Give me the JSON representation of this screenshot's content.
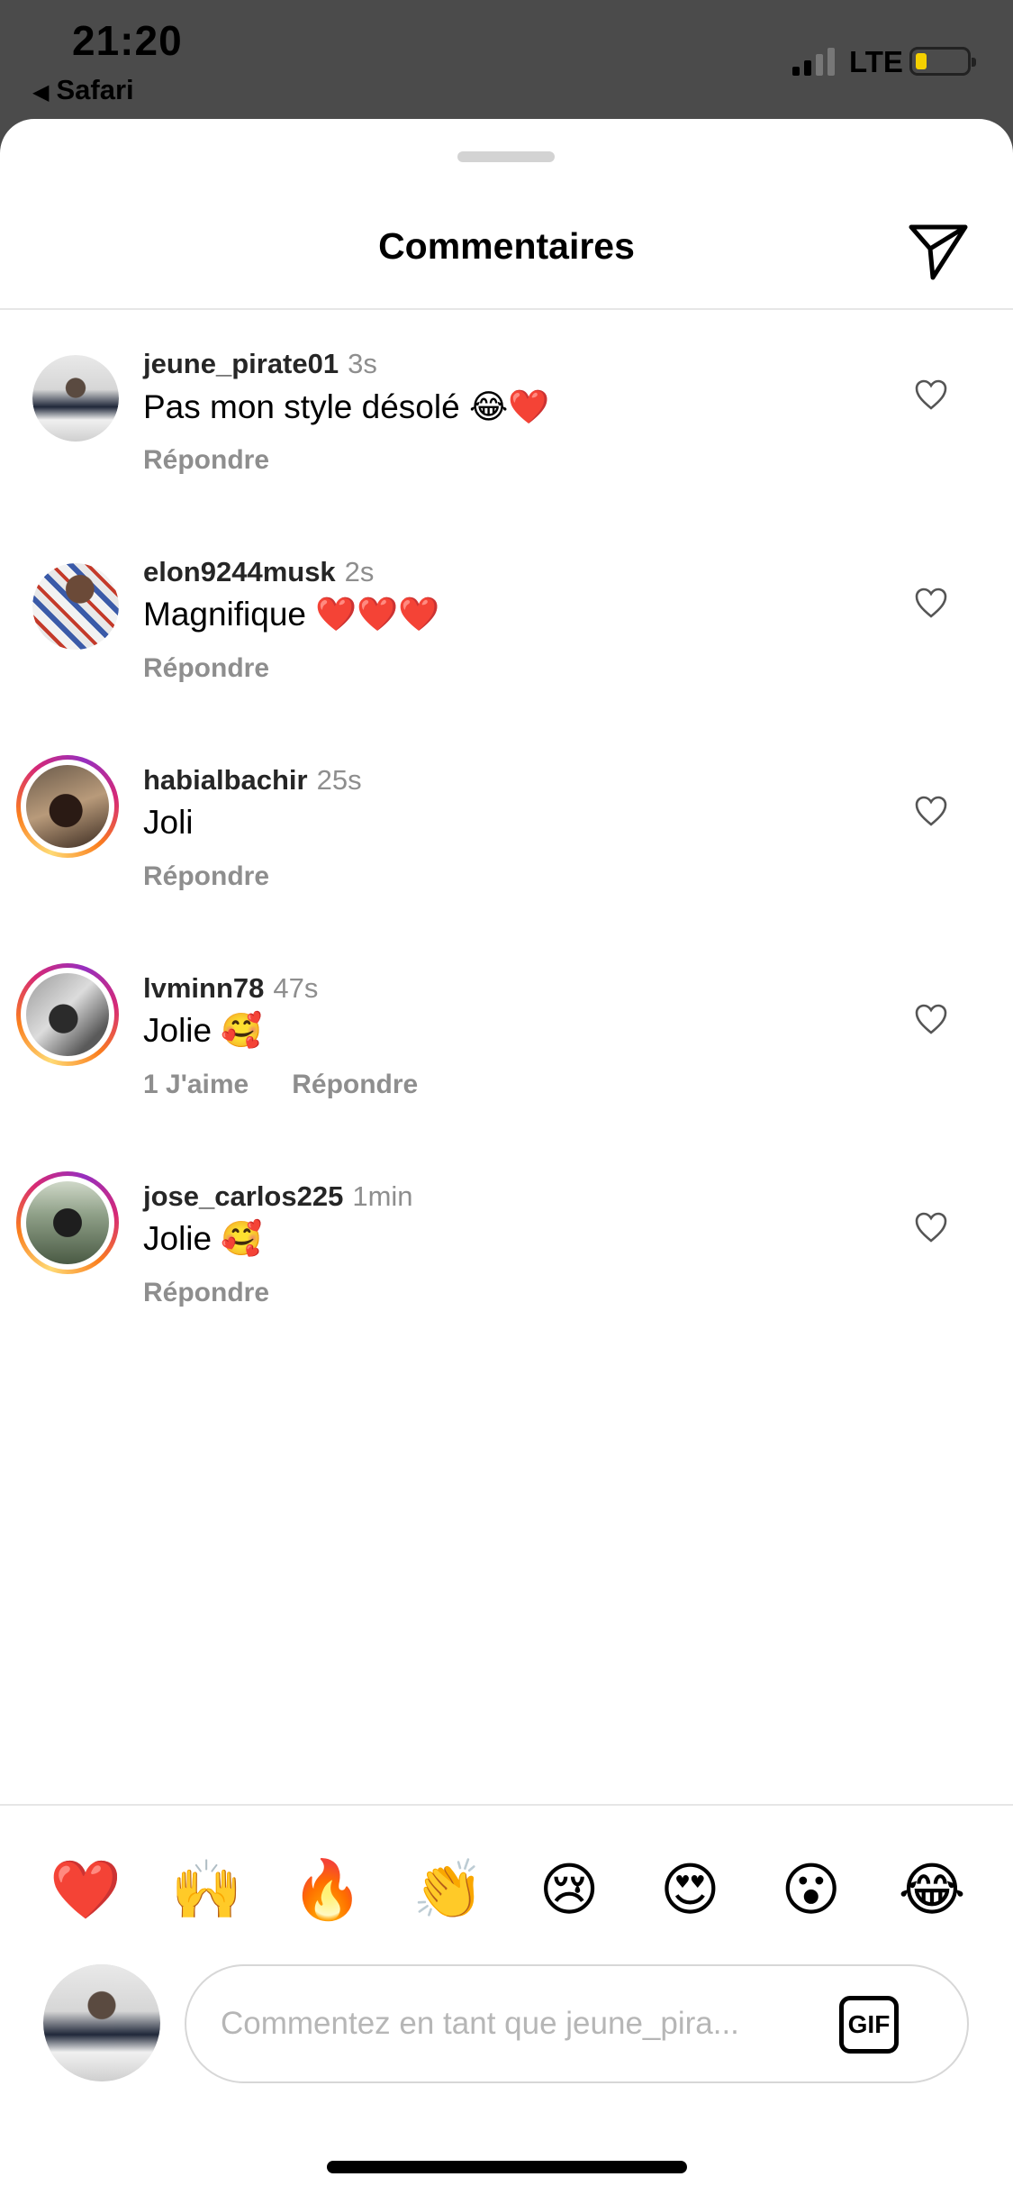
{
  "status_bar": {
    "time": "21:20",
    "back_app": "Safari",
    "network": "LTE",
    "battery_level_fraction": 0.15,
    "battery_color": "#f5d000"
  },
  "header": {
    "title": "Commentaires",
    "send_icon": "paper-plane-icon"
  },
  "comments": [
    {
      "username": "jeune_pirate01",
      "time": "3s",
      "text": "Pas mon style désolé 😂❤️",
      "likes": "",
      "reply": "Répondre",
      "has_story_ring": false
    },
    {
      "username": "elon9244musk",
      "time": "2s",
      "text": "Magnifique ❤️❤️❤️",
      "likes": "",
      "reply": "Répondre",
      "has_story_ring": false
    },
    {
      "username": "habialbachir",
      "time": "25s",
      "text": "Joli",
      "likes": "",
      "reply": "Répondre",
      "has_story_ring": true
    },
    {
      "username": "lvminn78",
      "time": "47s",
      "text": "Jolie 🥰",
      "likes": "1 J'aime",
      "reply": "Répondre",
      "has_story_ring": true
    },
    {
      "username": "jose_carlos225",
      "time": "1min",
      "text": "Jolie 🥰",
      "likes": "",
      "reply": "Répondre",
      "has_story_ring": true
    }
  ],
  "quick_emojis": [
    "❤️",
    "🙌",
    "🔥",
    "👏",
    "😢",
    "😍",
    "😮",
    "😂"
  ],
  "composer": {
    "placeholder": "Commentez en tant que jeune_pira...",
    "gif_label": "GIF"
  },
  "colors": {
    "muted_text": "#8e8e8e",
    "story_ring": [
      "#feda75",
      "#fa7e1e",
      "#d62976",
      "#962fbf"
    ]
  }
}
